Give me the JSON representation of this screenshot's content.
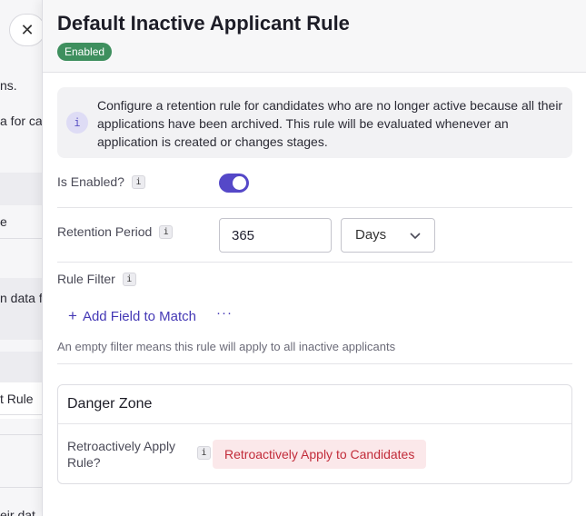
{
  "background": {
    "fragments": [
      "ns.",
      "a for ca",
      "e",
      "n data f",
      "t Rule",
      "eir dat"
    ]
  },
  "drawer": {
    "title": "Default Inactive Applicant Rule",
    "status_badge": "Enabled",
    "info": {
      "icon": "info-icon",
      "glyph": "i",
      "text": "Configure a retention rule for candidates who are no longer active because all their applications have been archived. This rule will be evaluated whenever an application is created or changes stages."
    },
    "is_enabled": {
      "label": "Is Enabled?",
      "tooltip_glyph": "i",
      "value": true
    },
    "retention_period": {
      "label": "Retention Period",
      "tooltip_glyph": "i",
      "value": "365",
      "unit": "Days"
    },
    "rule_filter": {
      "label": "Rule Filter",
      "tooltip_glyph": "i",
      "add_field_label": "Add Field to Match",
      "add_icon": "+",
      "more_label": "···",
      "hint": "An empty filter means this rule will apply to all inactive applicants"
    },
    "danger_zone": {
      "title": "Danger Zone",
      "label": "Retroactively Apply Rule?",
      "tooltip_glyph": "i",
      "button_label": "Retroactively Apply to Candidates"
    }
  },
  "close_glyph": "✕",
  "colors": {
    "accent": "#5548c8",
    "badge": "#3e8f5e",
    "danger_text": "#c22c3a",
    "danger_bg": "#fbe8ea"
  }
}
